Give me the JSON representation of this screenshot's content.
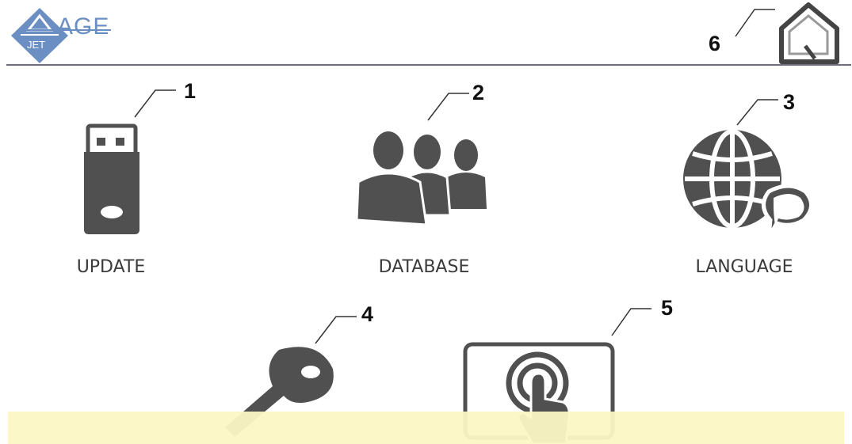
{
  "header": {
    "logo_top": "AGE",
    "logo_bottom": "JET",
    "home_callout": "6"
  },
  "menu": {
    "items": [
      {
        "label": "UPDATE",
        "callout": "1",
        "icon": "usb-drive-icon"
      },
      {
        "label": "DATABASE",
        "callout": "2",
        "icon": "users-group-icon"
      },
      {
        "label": "LANGUAGE",
        "callout": "3",
        "icon": "globe-chat-icon"
      },
      {
        "label": "",
        "callout": "4",
        "icon": "key-icon"
      },
      {
        "label": "",
        "callout": "5",
        "icon": "touch-icon"
      }
    ]
  },
  "colors": {
    "icon": "#505050",
    "logo_blue": "#6b8fc2",
    "header_line": "#6e6e80",
    "banner": "#fbf7c4"
  }
}
